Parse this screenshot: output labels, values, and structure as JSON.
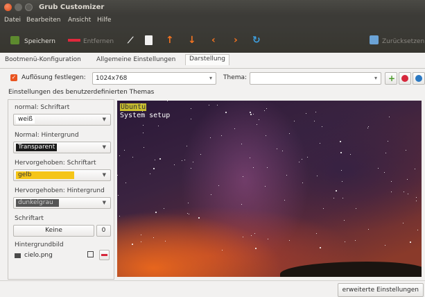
{
  "window": {
    "title": "Grub Customizer"
  },
  "menubar": [
    "Datei",
    "Bearbeiten",
    "Ansicht",
    "Hilfe"
  ],
  "toolbar": {
    "save_label": "Speichern",
    "remove_label": "Entfernen",
    "revert_label": "Zurücksetzen"
  },
  "tabs": [
    "Bootmenü-Konfiguration",
    "Allgemeine Einstellungen",
    "Darstellung"
  ],
  "resolution": {
    "checkbox_label": "Auflösung festlegen:",
    "value": "1024x768"
  },
  "theme": {
    "label": "Thema:",
    "value": ""
  },
  "custom_theme_header": "Einstellungen des benutzerdefinierten Themas",
  "settings": {
    "normal_font_label": "normal: Schriftart",
    "normal_font_value": "weiß",
    "normal_bg_label": "Normal: Hintergrund",
    "normal_bg_value": "Transparent",
    "highlight_font_label": "Hervorgehoben: Schriftart",
    "highlight_font_value": "gelb",
    "highlight_bg_label": "Hervorgehoben: Hintergrund",
    "highlight_bg_value": "dunkelgrau",
    "font_label": "Schriftart",
    "font_value": "Keine",
    "font_size": "0",
    "bg_image_label": "Hintergrundbild",
    "bg_image_value": "cielo.png"
  },
  "preview": {
    "line1": "Ubuntu",
    "line2": "System setup"
  },
  "advanced_button": "erweiterte Einstellungen",
  "colors": {
    "accent": "#e95420",
    "highlight_yellow": "#f5c518",
    "toolbar_dark": "#3c3b37"
  }
}
